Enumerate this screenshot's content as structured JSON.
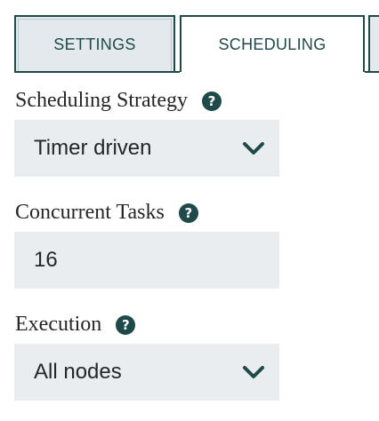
{
  "tabs": [
    {
      "label": "SETTINGS",
      "active": false
    },
    {
      "label": "SCHEDULING",
      "active": true
    }
  ],
  "fields": {
    "scheduling_strategy": {
      "label": "Scheduling Strategy",
      "value": "Timer driven",
      "control": "select"
    },
    "concurrent_tasks": {
      "label": "Concurrent Tasks",
      "value": "16",
      "control": "input"
    },
    "execution": {
      "label": "Execution",
      "value": "All nodes",
      "control": "select"
    }
  },
  "icons": {
    "help": "help-circle-icon",
    "dropdown": "chevron-down-icon"
  },
  "colors": {
    "accent": "#1f4a4a",
    "field_background": "#e9edf0",
    "text": "#262626"
  }
}
